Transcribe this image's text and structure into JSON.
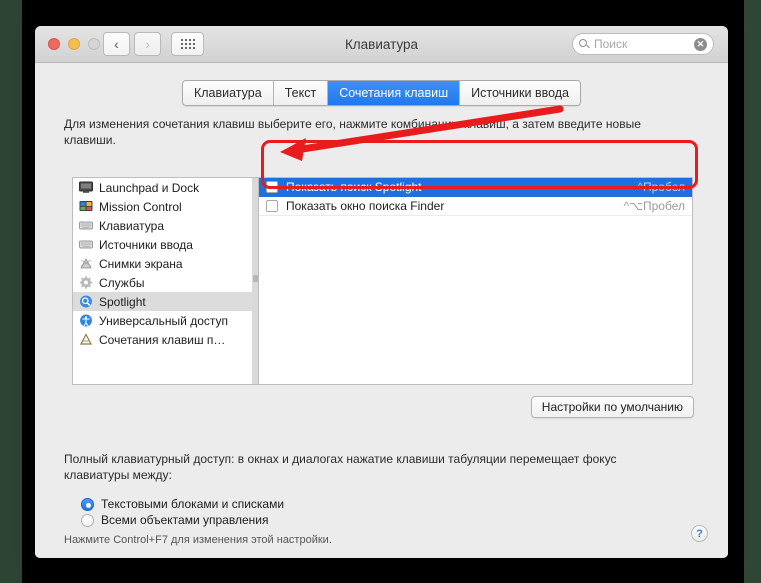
{
  "window": {
    "title": "Клавиатура",
    "traffic_lights": [
      "close",
      "minimize",
      "zoom"
    ],
    "nav": {
      "back": "‹",
      "forward": "›",
      "grid_icon": "grid-view-icon"
    },
    "search": {
      "placeholder": "Поиск",
      "value": "",
      "icon": "search-icon",
      "clear": "✕"
    }
  },
  "tabs": [
    {
      "label": "Клавиатура",
      "active": false
    },
    {
      "label": "Текст",
      "active": false
    },
    {
      "label": "Сочетания клавиш",
      "active": true
    },
    {
      "label": "Источники ввода",
      "active": false
    }
  ],
  "description": "Для изменения сочетания клавиш выберите его, нажмите комбинацию клавиш, а затем введите новые клавиши.",
  "categories": [
    {
      "label": "Launchpad и Dock",
      "icon": "monitor-icon",
      "selected": false
    },
    {
      "label": "Mission Control",
      "icon": "mission-control-icon",
      "selected": false
    },
    {
      "label": "Клавиатура",
      "icon": "keyboard-icon",
      "selected": false
    },
    {
      "label": "Источники ввода",
      "icon": "keyboard-icon",
      "selected": false
    },
    {
      "label": "Снимки экрана",
      "icon": "screenshot-icon",
      "selected": false
    },
    {
      "label": "Службы",
      "icon": "gear-icon",
      "selected": false
    },
    {
      "label": "Spotlight",
      "icon": "spotlight-icon",
      "selected": true
    },
    {
      "label": "Универсальный доступ",
      "icon": "accessibility-icon",
      "selected": false
    },
    {
      "label": "Сочетания клавиш п…",
      "icon": "app-shortcuts-icon",
      "selected": false
    }
  ],
  "shortcuts": [
    {
      "name": "Показать поиск Spotlight",
      "key": "^Пробел",
      "checked": false,
      "selected": true
    },
    {
      "name": "Показать окно поиска Finder",
      "key": "^⌥Пробел",
      "checked": false,
      "selected": false
    }
  ],
  "defaults_button": "Настройки по умолчанию",
  "keyboard_access": {
    "description": "Полный клавиатурный доступ: в окнах и диалогах нажатие клавиши табуляции перемещает фокус клавиатуры между:",
    "options": [
      {
        "label": "Текстовыми блоками и списками",
        "selected": true
      },
      {
        "label": "Всеми объектами управления",
        "selected": false
      }
    ],
    "hint": "Нажмите Control+F7 для изменения этой настройки."
  },
  "help_button": "?",
  "annotation": {
    "color": "#e81c1c",
    "shapes": [
      "rounded-rect-around-shortcut-list",
      "arrow-to-checkbox"
    ]
  }
}
